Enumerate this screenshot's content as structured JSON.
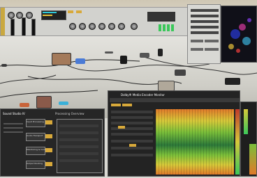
{
  "top_panel": {
    "title": "",
    "meters": [
      "",
      "",
      "",
      ""
    ]
  },
  "left_window": {
    "title": "Sound Studio IV",
    "header": "Processing Overview",
    "sections": [
      "Input Processing",
      "Audio Transport",
      "Monitoring & Control",
      "Output Routing"
    ],
    "accent": "#e8c23a"
  },
  "center_window": {
    "title": "Dolby® Media Encoder Monitor",
    "heatmap_colors": [
      "#2d7a3a",
      "#7bbf3a",
      "#d6c93a",
      "#e07a2a",
      "#c23a2a"
    ]
  },
  "right_panel": {
    "rows": 9
  },
  "colors": {
    "accent": "#e8c23a",
    "panel": "#2b2b2d"
  }
}
